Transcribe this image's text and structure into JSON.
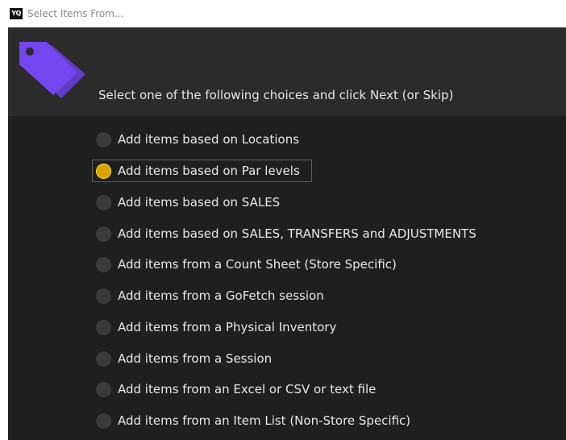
{
  "window": {
    "logo_text": "YQ",
    "title": "Select Items From..."
  },
  "header": {
    "icon": "price-tag-icon",
    "instruction": "Select one of the following choices and click Next (or Skip)"
  },
  "colors": {
    "header_bg": "#2b2b2b",
    "body_bg": "#1f1f1f",
    "icon_purple": "#6b3fe0",
    "radio_selected": "#d9a400"
  },
  "options": [
    {
      "label": "Add items based on Locations",
      "selected": false
    },
    {
      "label": "Add items based on Par levels",
      "selected": true
    },
    {
      "label": "Add items based on SALES",
      "selected": false
    },
    {
      "label": "Add items based on SALES, TRANSFERS and ADJUSTMENTS",
      "selected": false
    },
    {
      "label": "Add items from a Count Sheet (Store Specific)",
      "selected": false
    },
    {
      "label": "Add items from a GoFetch session",
      "selected": false
    },
    {
      "label": "Add items from a Physical Inventory",
      "selected": false
    },
    {
      "label": "Add items from a Session",
      "selected": false
    },
    {
      "label": "Add items from an Excel or CSV or text file",
      "selected": false
    },
    {
      "label": "Add items from an Item List (Non-Store Specific)",
      "selected": false
    }
  ]
}
